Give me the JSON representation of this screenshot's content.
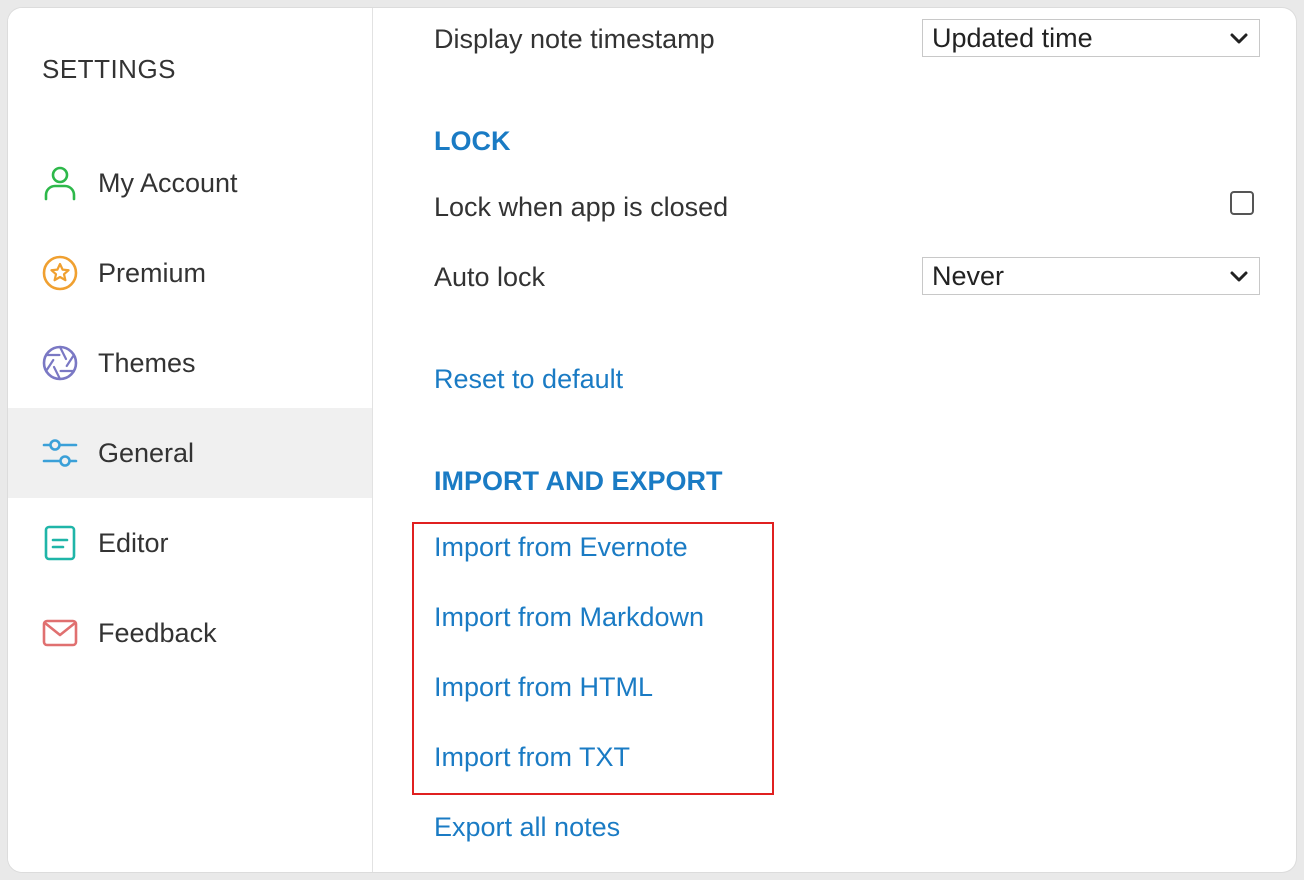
{
  "sidebar": {
    "title": "SETTINGS",
    "items": [
      {
        "label": "My Account",
        "icon": "user-icon",
        "color": "#2db84a"
      },
      {
        "label": "Premium",
        "icon": "star-badge-icon",
        "color": "#f0a030"
      },
      {
        "label": "Themes",
        "icon": "aperture-icon",
        "color": "#7a78c4"
      },
      {
        "label": "General",
        "icon": "sliders-icon",
        "color": "#3aa0d8",
        "active": true
      },
      {
        "label": "Editor",
        "icon": "document-icon",
        "color": "#1fb5a8"
      },
      {
        "label": "Feedback",
        "icon": "mail-icon",
        "color": "#e07070"
      }
    ]
  },
  "general": {
    "timestamp": {
      "label": "Display note timestamp",
      "value": "Updated time"
    },
    "lock": {
      "title": "LOCK",
      "lock_when_closed_label": "Lock when app is closed",
      "lock_when_closed_checked": false,
      "auto_lock_label": "Auto lock",
      "auto_lock_value": "Never"
    },
    "reset_label": "Reset to default",
    "import_export": {
      "title": "IMPORT AND EXPORT",
      "import_evernote": "Import from Evernote",
      "import_markdown": "Import from Markdown",
      "import_html": "Import from HTML",
      "import_txt": "Import from TXT",
      "export_all": "Export all notes"
    }
  },
  "colors": {
    "accent": "#1a7bc4",
    "highlight": "#e02020"
  }
}
